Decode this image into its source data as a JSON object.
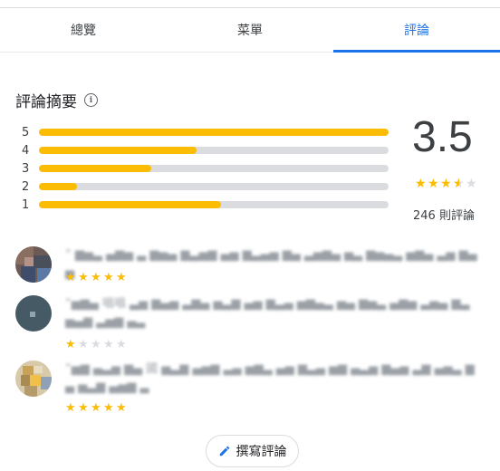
{
  "tabs": [
    {
      "label": "總覽",
      "active": false
    },
    {
      "label": "菜單",
      "active": false
    },
    {
      "label": "評論",
      "active": true
    }
  ],
  "summary": {
    "title": "評論摘要",
    "info_icon": "info-icon",
    "average": "3.5",
    "average_stars": 3.5,
    "count_text": "246 則評論",
    "distribution": [
      {
        "label": "5",
        "fraction": 1.0
      },
      {
        "label": "4",
        "fraction": 0.45
      },
      {
        "label": "3",
        "fraction": 0.32
      },
      {
        "label": "2",
        "fraction": 0.11
      },
      {
        "label": "1",
        "fraction": 0.52
      }
    ]
  },
  "reviews": [
    {
      "text": "“ ▆▅▃ ▄▆▅ ▃ ▆▅▄ ▆▃▅▆ ▄▅ ▆▃▄▅ ▆▄ ▃▅▆▄ ▅▃ ▆▅▄▃ ▅▆▄ ▃▅ ▆▄▅",
      "stars": 5
    },
    {
      "text": "“▅▆▄ 唱唱 ▃▅ ▆▄▅ ▃▆▄ ▅▃▆ ▄▅ ▆▃▄ ▅▆▄▃ ▅▄ ▆▅▃ ▄▆▅ ▃▅▄ ▆▃ ▅▄▆ ▃▅▆ ▄▃",
      "stars": 1
    },
    {
      "text": "“▅▆ ▄▃▅ ▆▄ 國 ▅▃▆ ▄▅▆ ▃▄ ▅▆▃ ▄▅ ▆▃▄ ▅▆ ▄▃▅ ▆▄▅ ▃▆ ▄▅▃ ▆▄ ▅▃▆ ▄▅▆ ▃",
      "stars": 5
    }
  ],
  "write_review": {
    "label": "撰寫評論",
    "icon": "pencil-icon"
  },
  "colors": {
    "accent": "#1a73e8",
    "star": "#fbbc04",
    "track": "#dadce0"
  }
}
